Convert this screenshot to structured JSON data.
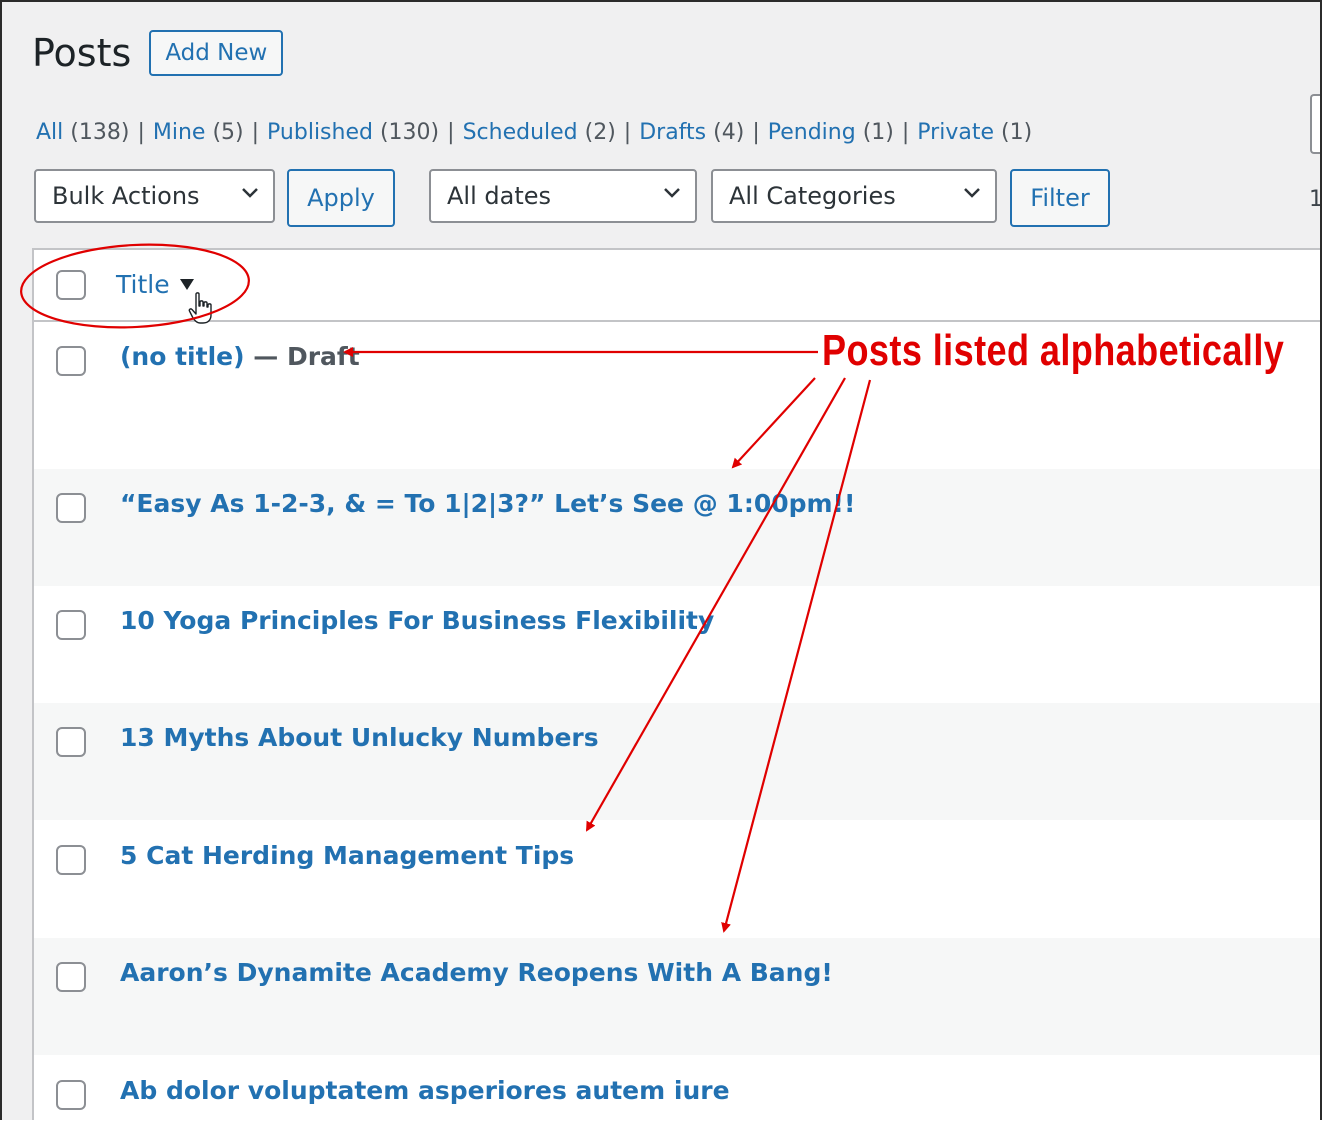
{
  "page": {
    "title": "Posts",
    "add_new_label": "Add New"
  },
  "filters": {
    "views": [
      {
        "label": "All",
        "count": "(138)"
      },
      {
        "label": "Mine",
        "count": "(5)"
      },
      {
        "label": "Published",
        "count": "(130)"
      },
      {
        "label": "Scheduled",
        "count": "(2)"
      },
      {
        "label": "Drafts",
        "count": "(4)"
      },
      {
        "label": "Pending",
        "count": "(1)"
      },
      {
        "label": "Private",
        "count": "(1)"
      }
    ],
    "separator": "|"
  },
  "tablenav": {
    "bulk_actions": "Bulk Actions",
    "apply_label": "Apply",
    "dates": "All dates",
    "categories": "All Categories",
    "filter_label": "Filter",
    "truncated_text": "1"
  },
  "table": {
    "column_title": "Title",
    "sort_icon": "sort-desc-icon",
    "rows": [
      {
        "title": "(no title)",
        "state": " — Draft"
      },
      {
        "title": "“Easy As 1-2-3, & = To 1|2|3?” Let’s See @ 1:00pm!!"
      },
      {
        "title": "10 Yoga Principles For Business Flexibility"
      },
      {
        "title": "13 Myths About Unlucky Numbers"
      },
      {
        "title": "5 Cat Herding Management Tips"
      },
      {
        "title": "Aaron’s Dynamite Academy Reopens With A Bang!"
      },
      {
        "title": "Ab dolor voluptatem asperiores autem iure"
      }
    ]
  },
  "annotation": {
    "callout": "Posts listed alphabetically",
    "color": "#e00000"
  },
  "colors": {
    "link": "#2271b1",
    "background": "#f0f0f1",
    "border": "#8c8f94"
  }
}
